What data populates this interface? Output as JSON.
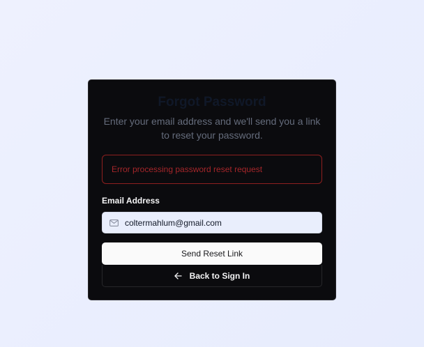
{
  "card": {
    "title": "Forgot Password",
    "subtitle": "Enter your email address and we'll send you a link to reset your password."
  },
  "error": {
    "message": "Error processing password reset request"
  },
  "form": {
    "email_label": "Email Address",
    "email_value": "coltermahlum@gmail.com",
    "submit_label": "Send Reset Link",
    "back_label": "Back to Sign In"
  },
  "icons": {
    "email": "mail-icon",
    "back": "arrow-left-icon"
  },
  "colors": {
    "card_background": "#0b0b0e",
    "page_background": "#eef1fe",
    "error": "#a5262a",
    "primary_button": "#fafafa"
  }
}
